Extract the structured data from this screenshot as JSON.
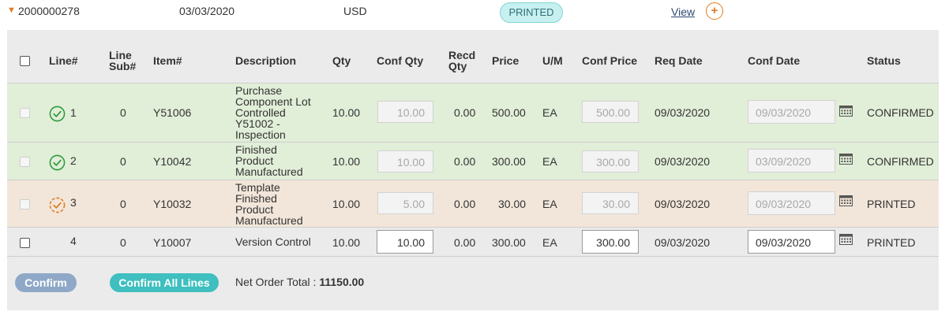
{
  "order": {
    "number": "2000000278",
    "date": "03/03/2020",
    "currency": "USD",
    "status": "PRINTED",
    "view_label": "View",
    "add_icon": "plus-circle-icon"
  },
  "table": {
    "headers": {
      "line": "Line#",
      "line_sub_1": "Line",
      "line_sub_2": "Sub#",
      "item": "Item#",
      "description": "Description",
      "qty": "Qty",
      "conf_qty": "Conf Qty",
      "recd_qty_1": "Recd",
      "recd_qty_2": "Qty",
      "price": "Price",
      "um": "U/M",
      "conf_price": "Conf Price",
      "req_date": "Req Date",
      "conf_date": "Conf Date",
      "status": "Status"
    },
    "rows": [
      {
        "line": "1",
        "line_sub": "0",
        "item": "Y51006",
        "description_lines": [
          "Purchase",
          "Component Lot",
          "Controlled",
          "Y51002 -",
          "Inspection"
        ],
        "qty": "10.00",
        "conf_qty": "10.00",
        "recd_qty": "0.00",
        "price": "500.00",
        "um": "EA",
        "conf_price": "500.00",
        "req_date": "09/03/2020",
        "conf_date": "09/03/2020",
        "status": "CONFIRMED",
        "status_icon": "check-circle-icon"
      },
      {
        "line": "2",
        "line_sub": "0",
        "item": "Y10042",
        "description_lines": [
          "Finished",
          "Product",
          "Manufactured"
        ],
        "qty": "10.00",
        "conf_qty": "10.00",
        "recd_qty": "0.00",
        "price": "300.00",
        "um": "EA",
        "conf_price": "300.00",
        "req_date": "09/03/2020",
        "conf_date": "03/09/2020",
        "status": "CONFIRMED",
        "status_icon": "check-circle-icon"
      },
      {
        "line": "3",
        "line_sub": "0",
        "item": "Y10032",
        "description_lines": [
          "Template",
          "Finished",
          "Product",
          "Manufactured"
        ],
        "qty": "10.00",
        "conf_qty": "5.00",
        "recd_qty": "0.00",
        "price": "30.00",
        "um": "EA",
        "conf_price": "30.00",
        "req_date": "09/03/2020",
        "conf_date": "09/03/2020",
        "status": "PRINTED",
        "status_icon": "partial-check-circle-icon"
      },
      {
        "line": "4",
        "line_sub": "0",
        "item": "Y10007",
        "description_lines": [
          "Version Control"
        ],
        "qty": "10.00",
        "conf_qty": "10.00",
        "recd_qty": "0.00",
        "price": "300.00",
        "um": "EA",
        "conf_price": "300.00",
        "req_date": "09/03/2020",
        "conf_date": "09/03/2020",
        "status": "PRINTED"
      }
    ]
  },
  "footer": {
    "confirm_label": "Confirm",
    "confirm_all_label": "Confirm All Lines",
    "net_total_label": "Net Order Total :",
    "net_total_value": "11150.00"
  },
  "colors": {
    "accent_orange": "#e07b1f",
    "confirmed_row": "#e1eed8",
    "printed_row": "#f2e6da",
    "check_green": "#2c9a3a",
    "button_teal": "#3fbfbf",
    "button_disabled": "#8fa8c7"
  }
}
